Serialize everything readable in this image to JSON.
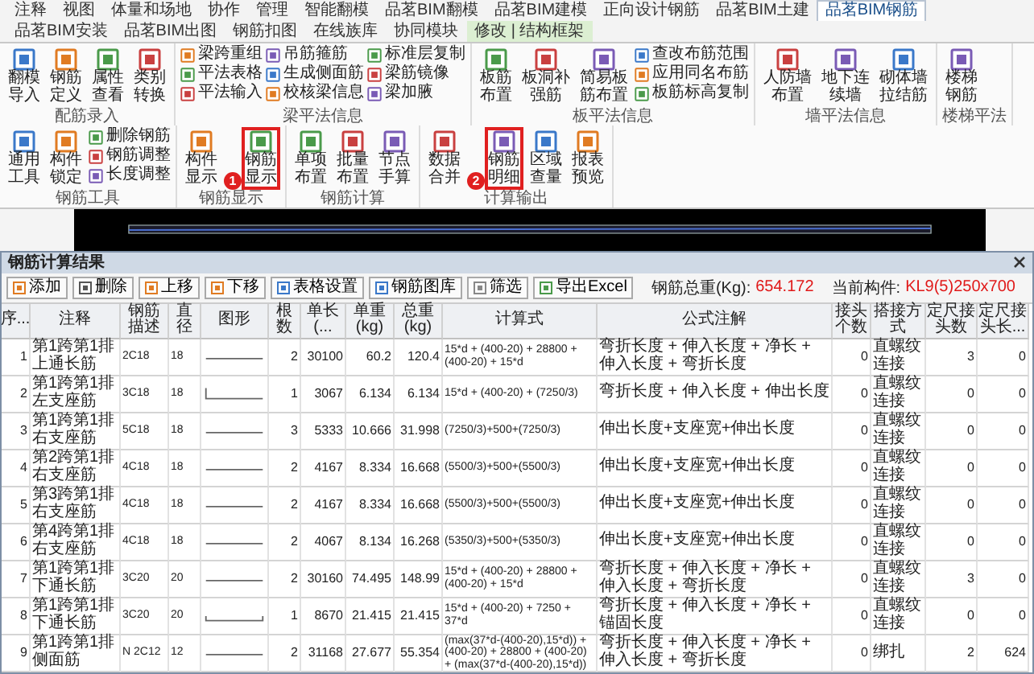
{
  "ribbon_tabs": [
    {
      "label": "注释",
      "selected": false,
      "kind": "normal"
    },
    {
      "label": "视图",
      "selected": false,
      "kind": "normal"
    },
    {
      "label": "体量和场地",
      "selected": false,
      "kind": "normal"
    },
    {
      "label": "协作",
      "selected": false,
      "kind": "normal"
    },
    {
      "label": "管理",
      "selected": false,
      "kind": "normal"
    },
    {
      "label": "智能翻模",
      "selected": false,
      "kind": "normal"
    },
    {
      "label": "品茗BIM翻模",
      "selected": false,
      "kind": "normal"
    },
    {
      "label": "品茗BIM建模",
      "selected": false,
      "kind": "normal"
    },
    {
      "label": "正向设计钢筋",
      "selected": false,
      "kind": "normal"
    },
    {
      "label": "品茗BIM土建",
      "selected": false,
      "kind": "normal"
    },
    {
      "label": "品茗BIM钢筋",
      "selected": true,
      "kind": "normal"
    },
    {
      "label": "品茗BIM安装",
      "selected": false,
      "kind": "normal"
    },
    {
      "label": "品茗BIM出图",
      "selected": false,
      "kind": "normal"
    },
    {
      "label": "钢筋扣图",
      "selected": false,
      "kind": "normal"
    },
    {
      "label": "在线族库",
      "selected": false,
      "kind": "normal"
    },
    {
      "label": "协同模块",
      "selected": false,
      "kind": "normal"
    },
    {
      "label": "修改 | 结构框架",
      "selected": false,
      "kind": "context"
    }
  ],
  "ribbon_groups": [
    {
      "label": "配筋录入",
      "items": [
        {
          "kind": "large",
          "label": "翻模导入",
          "highlighted": false
        },
        {
          "kind": "large",
          "label": "钢筋定义",
          "highlighted": false
        },
        {
          "kind": "large",
          "label": "属性查看",
          "highlighted": false
        },
        {
          "kind": "large",
          "label": "类别转换",
          "highlighted": false
        }
      ]
    },
    {
      "label": "梁平法信息",
      "items": [
        {
          "kind": "small",
          "label": "梁跨重组",
          "highlighted": false
        },
        {
          "kind": "small",
          "label": "平法表格",
          "highlighted": false
        },
        {
          "kind": "small",
          "label": "平法输入",
          "highlighted": false
        },
        {
          "kind": "small",
          "label": "吊筋箍筋",
          "highlighted": false
        },
        {
          "kind": "small",
          "label": "生成侧面筋",
          "highlighted": false
        },
        {
          "kind": "small",
          "label": "校核梁信息",
          "highlighted": false
        },
        {
          "kind": "small",
          "label": "标准层复制",
          "highlighted": false
        },
        {
          "kind": "small",
          "label": "梁筋镜像",
          "highlighted": false
        },
        {
          "kind": "small",
          "label": "梁加腋",
          "highlighted": false
        }
      ]
    },
    {
      "label": "板平法信息",
      "items": [
        {
          "kind": "large",
          "label": "板筋布置",
          "highlighted": false
        },
        {
          "kind": "large",
          "label": "板洞补强筋",
          "highlighted": false
        },
        {
          "kind": "large",
          "label": "简易板筋布置",
          "highlighted": false
        },
        {
          "kind": "small",
          "label": "查改布筋范围",
          "highlighted": false
        },
        {
          "kind": "small",
          "label": "应用同名布筋",
          "highlighted": false
        },
        {
          "kind": "small",
          "label": "板筋标高复制",
          "highlighted": false
        }
      ]
    },
    {
      "label": "墙平法信息",
      "items": [
        {
          "kind": "large",
          "label": "人防墙布置",
          "highlighted": false
        },
        {
          "kind": "large",
          "label": "地下连续墙",
          "highlighted": false
        },
        {
          "kind": "large",
          "label": "砌体墙拉结筋",
          "highlighted": false
        }
      ]
    },
    {
      "label": "楼梯平法",
      "items": [
        {
          "kind": "large",
          "label": "楼梯钢筋",
          "highlighted": false
        }
      ]
    },
    {
      "label": "钢筋工具",
      "items": [
        {
          "kind": "large",
          "label": "通用工具",
          "highlighted": false
        },
        {
          "kind": "large",
          "label": "构件锁定",
          "highlighted": false
        },
        {
          "kind": "small",
          "label": "删除钢筋",
          "highlighted": false
        },
        {
          "kind": "small",
          "label": "钢筋调整",
          "highlighted": false
        },
        {
          "kind": "small",
          "label": "长度调整",
          "highlighted": false
        }
      ]
    },
    {
      "label": "钢筋显示",
      "items": [
        {
          "kind": "large",
          "label": "构件显示",
          "highlighted": false
        },
        {
          "kind": "large",
          "label": "钢筋显示",
          "highlighted": true,
          "badge": "1"
        }
      ]
    },
    {
      "label": "钢筋计算",
      "items": [
        {
          "kind": "large",
          "label": "单项布置",
          "highlighted": false
        },
        {
          "kind": "large",
          "label": "批量布置",
          "highlighted": false
        },
        {
          "kind": "large",
          "label": "节点手算",
          "highlighted": false
        }
      ]
    },
    {
      "label": "计算输出",
      "items": [
        {
          "kind": "large",
          "label": "数据合并",
          "highlighted": false
        },
        {
          "kind": "large",
          "label": "钢筋明细",
          "highlighted": true,
          "badge": "2"
        },
        {
          "kind": "large",
          "label": "区域查量",
          "highlighted": false
        },
        {
          "kind": "large",
          "label": "报表预览",
          "highlighted": false
        }
      ]
    }
  ],
  "dialog": {
    "title": "钢筋计算结果",
    "toolbar": [
      "添加",
      "删除",
      "上移",
      "下移",
      "表格设置",
      "钢筋图库",
      "筛选",
      "导出Excel"
    ],
    "total_weight_label": "钢筋总重(Kg):",
    "total_weight": "654.172",
    "current_member_label": "当前构件:",
    "current_member": "KL9(5)250x700",
    "columns": [
      "序...",
      "注释",
      "钢筋描述",
      "直径",
      "图形",
      "根数",
      "单长(...",
      "单重(kg)",
      "总重(kg)",
      "计算式",
      "公式注解",
      "接头个数",
      "搭接方式",
      "定尺接头数",
      "定尺接头长..."
    ],
    "rows": [
      {
        "no": "1",
        "note": "第1跨第1排上通长筋",
        "desc": "2C18",
        "diameter": "18",
        "kind": "straight",
        "count": "2",
        "unit_length": "30100",
        "unit_weight": "60.2",
        "total_weight": "120.4",
        "formula": "15*d + (400-20) + 28800 + (400-20) + 15*d",
        "formula_note": "弯折长度 + 伸入长度 + 净长 + 伸入长度 + 弯折长度",
        "joints": "0",
        "splice": "直螺纹连接",
        "fixed_joints": "3",
        "fixed_joint_length": "0"
      },
      {
        "no": "2",
        "note": "第1跨第1排左支座筋",
        "desc": "3C18",
        "diameter": "18",
        "kind": "left-hook",
        "count": "1",
        "unit_length": "3067",
        "unit_weight": "6.134",
        "total_weight": "6.134",
        "formula": "15*d + (400-20) + (7250/3)",
        "formula_note": "弯折长度 + 伸入长度 + 伸出长度",
        "joints": "0",
        "splice": "直螺纹连接",
        "fixed_joints": "0",
        "fixed_joint_length": "0"
      },
      {
        "no": "3",
        "note": "第1跨第1排右支座筋",
        "desc": "5C18",
        "diameter": "18",
        "kind": "straight",
        "count": "3",
        "unit_length": "5333",
        "unit_weight": "10.666",
        "total_weight": "31.998",
        "formula": "(7250/3)+500+(7250/3)",
        "formula_note": "伸出长度+支座宽+伸出长度",
        "joints": "0",
        "splice": "直螺纹连接",
        "fixed_joints": "0",
        "fixed_joint_length": "0"
      },
      {
        "no": "4",
        "note": "第2跨第1排右支座筋",
        "desc": "4C18",
        "diameter": "18",
        "kind": "straight",
        "count": "2",
        "unit_length": "4167",
        "unit_weight": "8.334",
        "total_weight": "16.668",
        "formula": "(5500/3)+500+(5500/3)",
        "formula_note": "伸出长度+支座宽+伸出长度",
        "joints": "0",
        "splice": "直螺纹连接",
        "fixed_joints": "0",
        "fixed_joint_length": "0"
      },
      {
        "no": "5",
        "note": "第3跨第1排右支座筋",
        "desc": "4C18",
        "diameter": "18",
        "kind": "straight",
        "count": "2",
        "unit_length": "4167",
        "unit_weight": "8.334",
        "total_weight": "16.668",
        "formula": "(5500/3)+500+(5500/3)",
        "formula_note": "伸出长度+支座宽+伸出长度",
        "joints": "0",
        "splice": "直螺纹连接",
        "fixed_joints": "0",
        "fixed_joint_length": "0"
      },
      {
        "no": "6",
        "note": "第4跨第1排右支座筋",
        "desc": "4C18",
        "diameter": "18",
        "kind": "straight",
        "count": "2",
        "unit_length": "4067",
        "unit_weight": "8.134",
        "total_weight": "16.268",
        "formula": "(5350/3)+500+(5350/3)",
        "formula_note": "伸出长度+支座宽+伸出长度",
        "joints": "0",
        "splice": "直螺纹连接",
        "fixed_joints": "0",
        "fixed_joint_length": "0"
      },
      {
        "no": "7",
        "note": "第1跨第1排下通长筋",
        "desc": "3C20",
        "diameter": "20",
        "kind": "straight",
        "count": "2",
        "unit_length": "30160",
        "unit_weight": "74.495",
        "total_weight": "148.99",
        "formula": "15*d + (400-20) + 28800 + (400-20) + 15*d",
        "formula_note": "弯折长度 + 伸入长度 + 净长 + 伸入长度 + 弯折长度",
        "joints": "0",
        "splice": "直螺纹连接",
        "fixed_joints": "3",
        "fixed_joint_length": "0"
      },
      {
        "no": "8",
        "note": "第1跨第1排下通长筋",
        "desc": "3C20",
        "diameter": "20",
        "kind": "both-hooks",
        "count": "1",
        "unit_length": "8670",
        "unit_weight": "21.415",
        "total_weight": "21.415",
        "formula": "15*d + (400-20) + 7250 + 37*d",
        "formula_note": "弯折长度 + 伸入长度 + 净长 + 锚固长度",
        "joints": "0",
        "splice": "直螺纹连接",
        "fixed_joints": "0",
        "fixed_joint_length": "0"
      },
      {
        "no": "9",
        "note": "第1跨第1排侧面筋",
        "desc": "N 2C12",
        "diameter": "12",
        "kind": "straight",
        "count": "2",
        "unit_length": "31168",
        "unit_weight": "27.677",
        "total_weight": "55.354",
        "formula": "(max(37*d-(400-20),15*d)) + (400-20) + 28800 + (400-20) + (max(37*d-(400-20),15*d))",
        "formula_note": "弯折长度 + 伸入长度 + 净长 + 伸入长度 + 弯折长度",
        "joints": "0",
        "splice": "绑扎",
        "fixed_joints": "2",
        "fixed_joint_length": "624"
      }
    ]
  }
}
